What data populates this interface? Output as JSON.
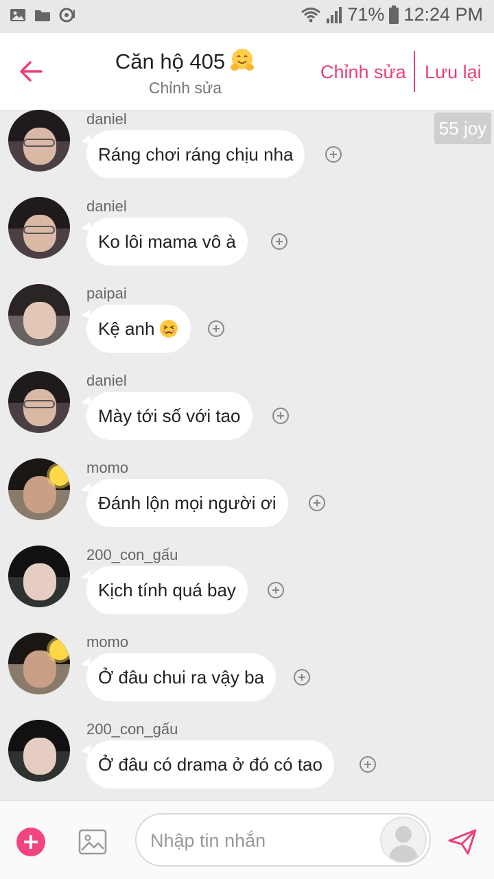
{
  "status_bar": {
    "battery": "71%",
    "time": "12:24 PM"
  },
  "header": {
    "title": "Căn hộ 405",
    "title_emoji": "hugging-face",
    "subtitle": "Chỉnh sửa",
    "edit_label": "Chỉnh sửa",
    "save_label": "Lưu lại",
    "accent_color": "#ec3f7c"
  },
  "joy_badge": "55 joy",
  "messages": [
    {
      "user": "daniel",
      "text": "Ráng chơi ráng chịu nha",
      "avatar": "daniel-photo"
    },
    {
      "user": "daniel",
      "text": "Ko lôi mama vô à",
      "avatar": "daniel-photo"
    },
    {
      "user": "paipai",
      "text": "Kệ anh",
      "emoji": "persevering-face",
      "avatar": "paipai-photo"
    },
    {
      "user": "daniel",
      "text": "Mày tới số với tao",
      "avatar": "daniel-photo"
    },
    {
      "user": "momo",
      "text": "Đánh lộn mọi người ơi",
      "avatar": "momo-photo"
    },
    {
      "user": "200_con_gấu",
      "text": "Kịch tính quá bay",
      "avatar": "200-con-gau-photo"
    },
    {
      "user": "momo",
      "text": "Ở đâu chui ra vậy ba",
      "avatar": "momo-photo"
    },
    {
      "user": "200_con_gấu",
      "text": "Ở đâu có drama ở đó có tao",
      "avatar": "200-con-gau-photo"
    }
  ],
  "composer": {
    "placeholder": "Nhập tin nhắn",
    "accent_color": "#f2457e"
  }
}
